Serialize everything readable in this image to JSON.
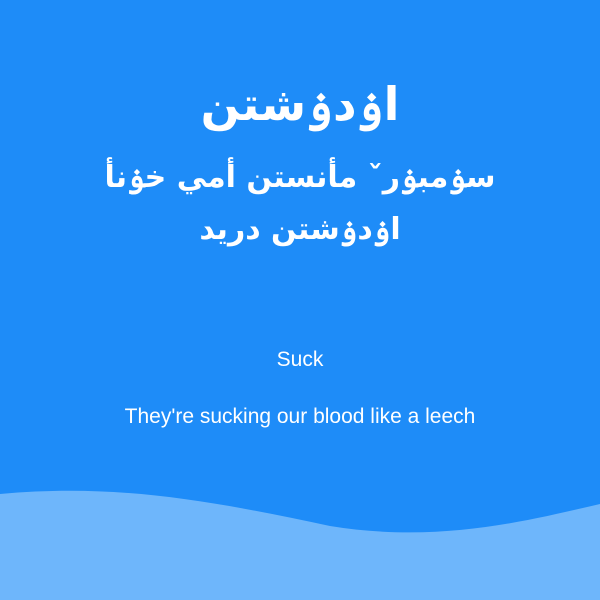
{
  "card": {
    "title": "اۏدۏشتن",
    "subtitle": "سۏمبۏرˇ مأنستن أمي خۏنأ اۏدۏشتن دريد",
    "word": "Suck",
    "sentence": "They're sucking our blood like a leech"
  },
  "colors": {
    "background": "#1e8cf8",
    "wave": "#6eb6fb",
    "text": "#ffffff"
  }
}
